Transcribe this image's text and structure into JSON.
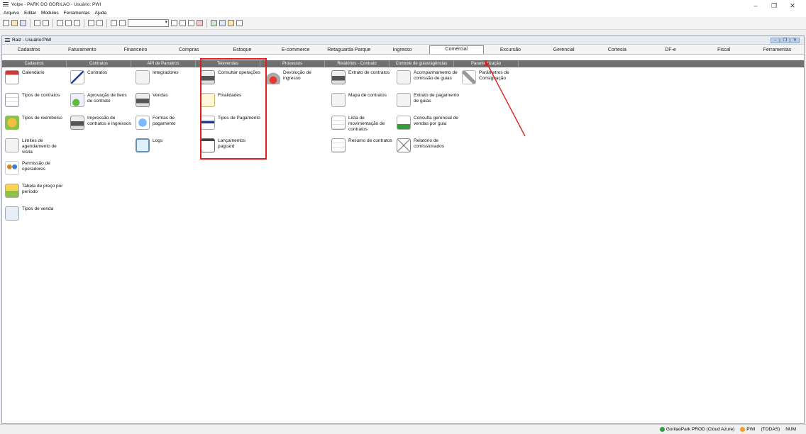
{
  "window": {
    "title": "Volpe - PARK DO GORILAO - Usuário: PWI"
  },
  "menu": [
    "Arquivo",
    "Editar",
    "Módulos",
    "Ferramentas",
    "Ajuda"
  ],
  "mdi": {
    "title": "Raiz - Usuário:PWI"
  },
  "tabs": [
    "Cadastros",
    "Faturamento",
    "Financeiro",
    "Compras",
    "Estoque",
    "E-commerce",
    "Retaguarda Parque",
    "Ingresso",
    "Comercial",
    "Excursão",
    "Gerencial",
    "Cortesia",
    "DF-e",
    "Fiscal",
    "Ferramentas"
  ],
  "active_tab": "Comercial",
  "subtabs": [
    "Cadastros",
    "Contratos",
    "API de Parceiros",
    "Televendas",
    "Processos",
    "Relatórios - Contrato",
    "Controle de guias/agências",
    "Parametrização"
  ],
  "columns": [
    {
      "items": [
        {
          "label": "Calendário",
          "icon": "calendar-icon",
          "style": "calendar"
        },
        {
          "label": "Tipos de contratos",
          "icon": "list-icon",
          "style": "grid3"
        },
        {
          "label": "Tipos de reembolso",
          "icon": "coins-icon",
          "style": "coins"
        },
        {
          "label": "Limites de agendamento de visita",
          "icon": "schedule-icon",
          "style": "doc"
        },
        {
          "label": "Permissão de operadores",
          "icon": "people-icon",
          "style": "people"
        },
        {
          "label": "Tabela de preço por período",
          "icon": "price-table-icon",
          "style": "price"
        },
        {
          "label": "Tipos de venda",
          "icon": "cart-icon",
          "style": "cart"
        }
      ]
    },
    {
      "items": [
        {
          "label": "Contratos",
          "icon": "pen-icon",
          "style": "pen"
        },
        {
          "label": "Aprovação de itens de contrato",
          "icon": "approve-icon",
          "style": "check"
        },
        {
          "label": "Impressão de contratos e ingressos",
          "icon": "printer-icon",
          "style": "printer"
        }
      ]
    },
    {
      "items": [
        {
          "label": "Integradores",
          "icon": "integration-icon",
          "style": "doc"
        },
        {
          "label": "Vendas",
          "icon": "sales-icon",
          "style": "printer"
        },
        {
          "label": "Formas de pagamento",
          "icon": "payment-icon",
          "style": "globe"
        },
        {
          "label": "Logs",
          "icon": "monitor-icon",
          "style": "monitor"
        }
      ]
    },
    {
      "items": [
        {
          "label": "Consultar operações",
          "icon": "phone-icon",
          "style": "printer"
        },
        {
          "label": "Finalidades",
          "icon": "notes-icon",
          "style": "notes"
        },
        {
          "label": "Tipos de Pagamento",
          "icon": "credit-card-icon",
          "style": "card"
        },
        {
          "label": "Lançamentos pagcard",
          "icon": "clipboard-icon",
          "style": "clip"
        }
      ]
    },
    {
      "items": [
        {
          "label": "Devolução de ingresso",
          "icon": "refund-icon",
          "style": "ok"
        }
      ]
    },
    {
      "items": [
        {
          "label": "Extrato de contratos",
          "icon": "statement-icon",
          "style": "printer"
        },
        {
          "label": "Mapa de contratos",
          "icon": "map-icon",
          "style": "doc"
        },
        {
          "label": "Lista de movimentação de contratos",
          "icon": "list-icon",
          "style": "grid3"
        },
        {
          "label": "Resumo de contratos",
          "icon": "summary-icon",
          "style": "grid3"
        }
      ]
    },
    {
      "items": [
        {
          "label": "Acompanhamento de comissão de guias",
          "icon": "commission-icon",
          "style": "doc"
        },
        {
          "label": "Extrato de pagamento de guias",
          "icon": "statement-icon",
          "style": "doc"
        },
        {
          "label": "Consulta gerencial de vendas por guia",
          "icon": "chart-icon",
          "style": "chart"
        },
        {
          "label": "Relatório de comissionados",
          "icon": "placeholder-icon",
          "style": "cross"
        }
      ]
    },
    {
      "items": [
        {
          "label": "Parâmetros de Consignação",
          "icon": "tools-icon",
          "style": "tools"
        }
      ]
    }
  ],
  "status": {
    "connection": "GorilaoPark PROD (Cloud Azure)",
    "user": "PWI",
    "scope": "(TODAS)",
    "numlock": "NUM"
  },
  "colors": {
    "highlight": "#e02020",
    "subtab_bg": "#707070"
  }
}
